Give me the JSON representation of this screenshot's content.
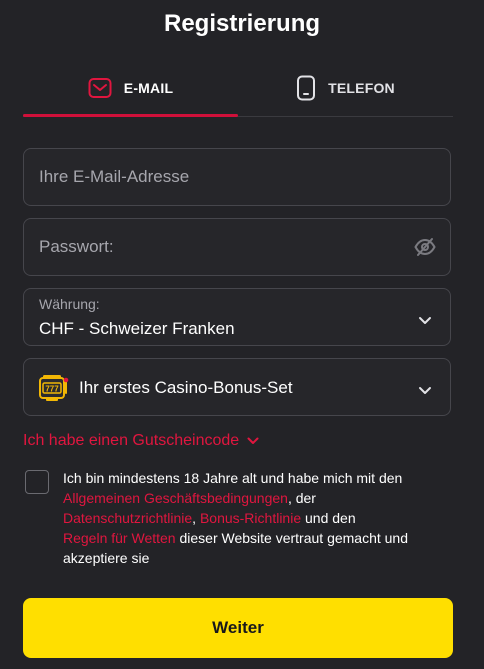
{
  "header": {
    "title": "Registrierung"
  },
  "tabs": [
    {
      "label": "E-MAIL",
      "icon": "envelope-icon",
      "active": true
    },
    {
      "label": "TELEFON",
      "icon": "phone-icon",
      "active": false
    }
  ],
  "form": {
    "email": {
      "value": "",
      "placeholder": "Ihre E-Mail-Adresse"
    },
    "password": {
      "value": "",
      "placeholder": "Passwort:",
      "toggle_icon": "eye-off-icon"
    },
    "currency": {
      "label": "Währung:",
      "value": "CHF - Schweizer Franken"
    },
    "bonus": {
      "value": "Ihr erstes Casino-Bonus-Set",
      "icon": "slot-machine-icon"
    },
    "voucher_label": "Ich habe einen Gutscheincode",
    "terms": {
      "t1": "Ich bin mindestens 18 Jahre alt und habe mich mit den ",
      "l1": "Allgemeinen Geschäftsbedingungen",
      "t2": ", der ",
      "l2": "Datenschutzrichtlinie",
      "t3": ", ",
      "l3": "Bonus-Richtlinie",
      "t4": " und den ",
      "l4": "Regeln für Wetten",
      "t5": " dieser Website vertraut gemacht und akzeptiere sie"
    },
    "submit_label": "Weiter"
  },
  "colors": {
    "background": "#232327",
    "accent": "#e0163f",
    "submit": "#ffdf00"
  }
}
